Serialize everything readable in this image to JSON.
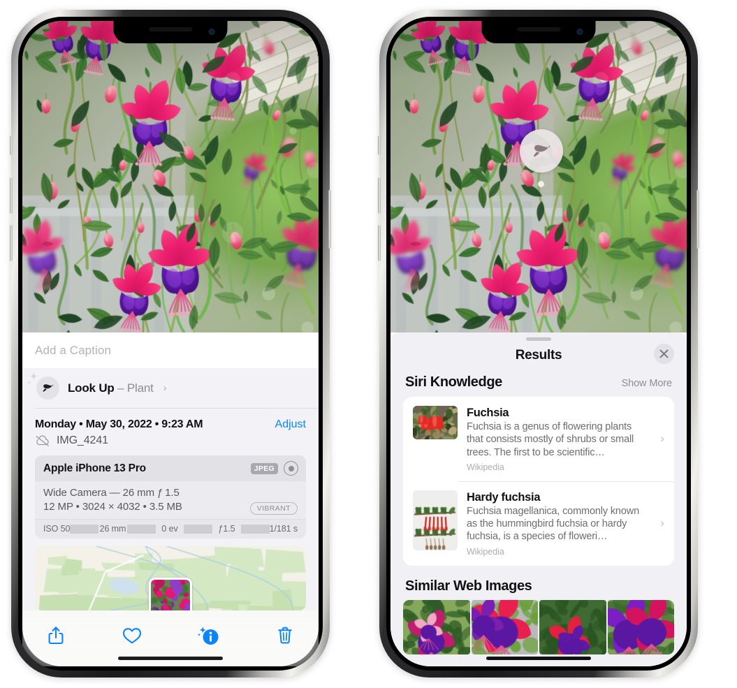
{
  "left_phone": {
    "caption": {
      "placeholder": "Add a Caption",
      "value": ""
    },
    "lookup": {
      "icon": "leaf-icon",
      "label": "Look Up",
      "dash": " – ",
      "subject": "Plant",
      "chevron": "›"
    },
    "metadata": {
      "date": "Monday • May 30, 2022 • 9:23 AM",
      "adjust_label": "Adjust",
      "cloud_icon": "cloud-slash-icon",
      "filename": "IMG_4241"
    },
    "camera_card": {
      "device": "Apple iPhone 13 Pro",
      "format_badge": "JPEG",
      "lens_icon": "lens-icon",
      "lens_line": "Wide Camera — 26 mm ƒ 1.5",
      "spec_line": "12 MP • 3024 × 4032 • 3.5 MB",
      "vibrant_badge": "VIBRANT",
      "exif": [
        "ISO 50",
        "26 mm",
        "0 ev",
        "ƒ1.5",
        "1/181 s"
      ]
    },
    "toolbar": [
      {
        "name": "share-button",
        "icon": "share-icon"
      },
      {
        "name": "favorite-button",
        "icon": "heart-icon"
      },
      {
        "name": "info-button",
        "icon": "info-sparkle-icon"
      },
      {
        "name": "delete-button",
        "icon": "trash-icon"
      }
    ],
    "accent_color": "#0a84ff"
  },
  "right_phone": {
    "visual_lookup_badge": {
      "icon": "leaf-icon"
    },
    "sheet": {
      "title": "Results",
      "close_icon": "close-icon",
      "grabber": "drag-handle"
    },
    "siri_knowledge": {
      "title": "Siri Knowledge",
      "show_more": "Show More",
      "items": [
        {
          "name": "Fuchsia",
          "description": "Fuchsia is a genus of flowering plants that consists mostly of shrubs or small trees. The first to be scientific…",
          "source": "Wikipedia",
          "chevron": "›"
        },
        {
          "name": "Hardy fuchsia",
          "description": "Fuchsia magellanica, commonly known as the hummingbird fuchsia or hardy fuchsia, is a species of floweri…",
          "source": "Wikipedia",
          "chevron": "›"
        }
      ]
    },
    "similar_web_images": {
      "title": "Similar Web Images",
      "count": 4
    }
  }
}
